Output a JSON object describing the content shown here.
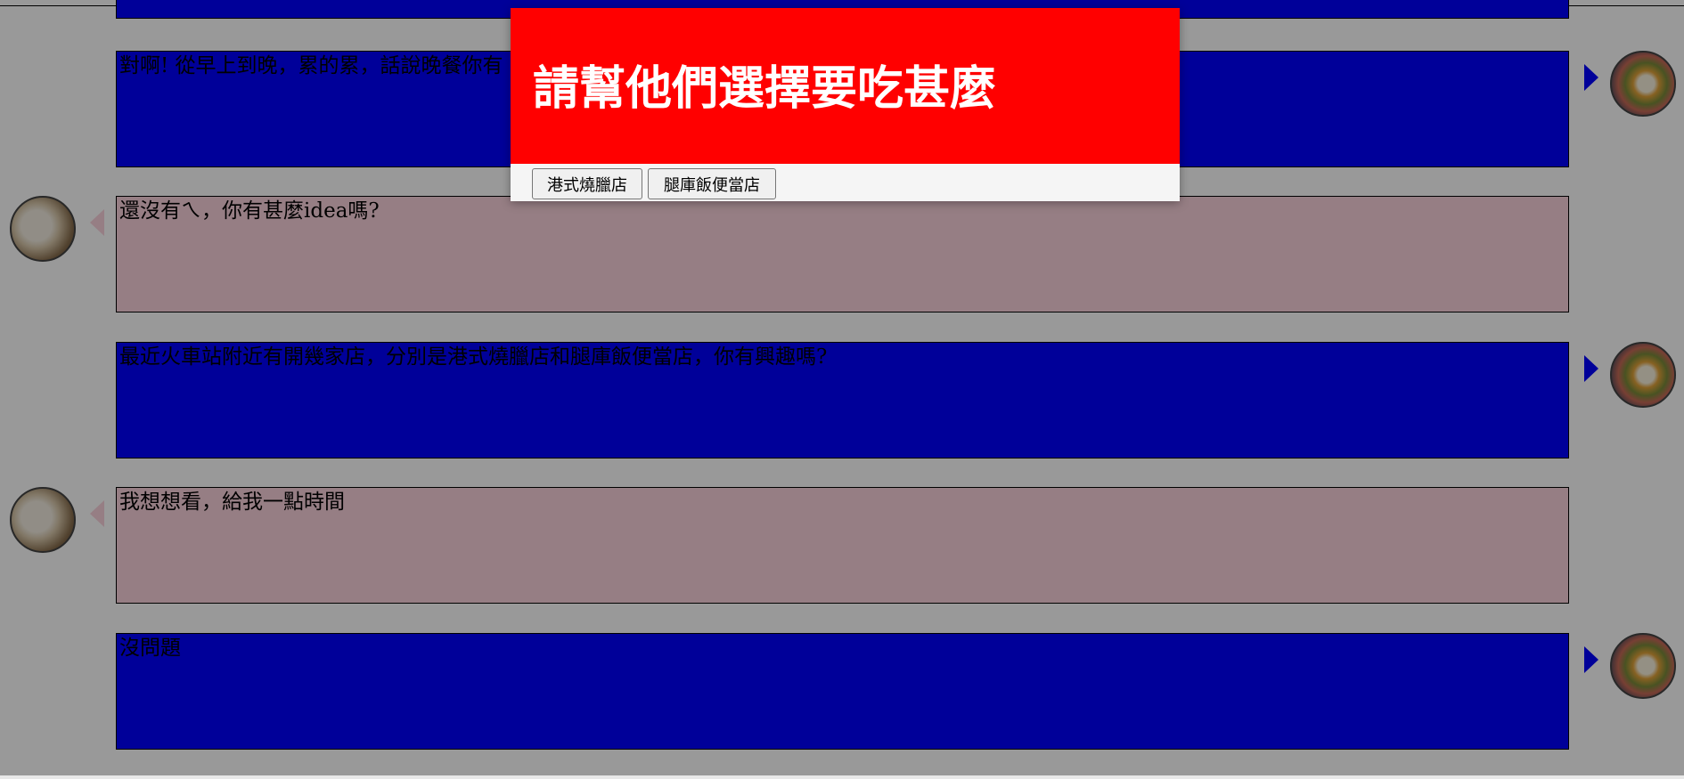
{
  "messages": [
    {
      "side": "right",
      "text": ""
    },
    {
      "side": "right",
      "text": "對啊! 從早上到晚，累的累，話說晚餐你有"
    },
    {
      "side": "left",
      "text": "還沒有ㄟ，你有甚麼idea嗎?"
    },
    {
      "side": "right",
      "text": "最近火車站附近有開幾家店，分別是港式燒臘店和腿庫飯便當店，你有興趣嗎?"
    },
    {
      "side": "left",
      "text": "我想想看，給我一點時間"
    },
    {
      "side": "right",
      "text": "沒問題"
    }
  ],
  "modal": {
    "title": "請幫他們選擇要吃甚麼",
    "options": [
      "港式燒臘店",
      "腿庫飯便當店"
    ]
  },
  "colors": {
    "left_bubble": "#fad2dc",
    "right_bubble": "#0000ff",
    "modal_header": "#ff0000"
  },
  "icons": {
    "left_avatar": "dumpling-avatar-icon",
    "right_avatar": "ramen-avatar-icon"
  }
}
